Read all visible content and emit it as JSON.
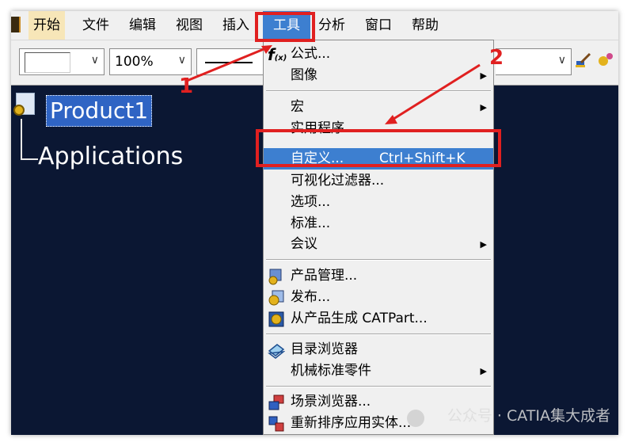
{
  "menubar": {
    "items": [
      {
        "label": "开始"
      },
      {
        "label": "文件"
      },
      {
        "label": "编辑"
      },
      {
        "label": "视图"
      },
      {
        "label": "插入"
      },
      {
        "label": "工具"
      },
      {
        "label": "分析"
      },
      {
        "label": "窗口"
      },
      {
        "label": "帮助"
      }
    ]
  },
  "toolbar": {
    "zoom_value": "100%"
  },
  "tree": {
    "root": "Product1",
    "child": "Applications"
  },
  "tools_menu": {
    "items": [
      {
        "label": "公式...",
        "icon": "formula-icon"
      },
      {
        "label": "图像",
        "submenu": true
      },
      {
        "label": "宏",
        "submenu": true
      },
      {
        "label": "实用程序..."
      },
      {
        "label": "自定义...",
        "shortcut": "Ctrl+Shift+K",
        "highlighted": true
      },
      {
        "label": "可视化过滤器..."
      },
      {
        "label": "选项..."
      },
      {
        "label": "标准..."
      },
      {
        "label": "会议",
        "submenu": true
      },
      {
        "label": "产品管理...",
        "icon": "product-management-icon"
      },
      {
        "label": "发布...",
        "icon": "publish-icon"
      },
      {
        "label": "从产品生成 CATPart...",
        "icon": "generate-catpart-icon"
      },
      {
        "label": "目录浏览器",
        "icon": "catalog-browser-icon"
      },
      {
        "label": "机械标准零件",
        "submenu": true
      },
      {
        "label": "场景浏览器...",
        "icon": "scene-browser-icon"
      },
      {
        "label": "重新排序应用实体...",
        "icon": "reorder-icon"
      }
    ]
  },
  "annotations": {
    "step1": "1",
    "step2": "2"
  },
  "watermark": "公众号 · CATIA集大成者",
  "colors": {
    "highlight": "#3d7fd0",
    "annotation": "#e02020",
    "background": "#0b1733"
  }
}
